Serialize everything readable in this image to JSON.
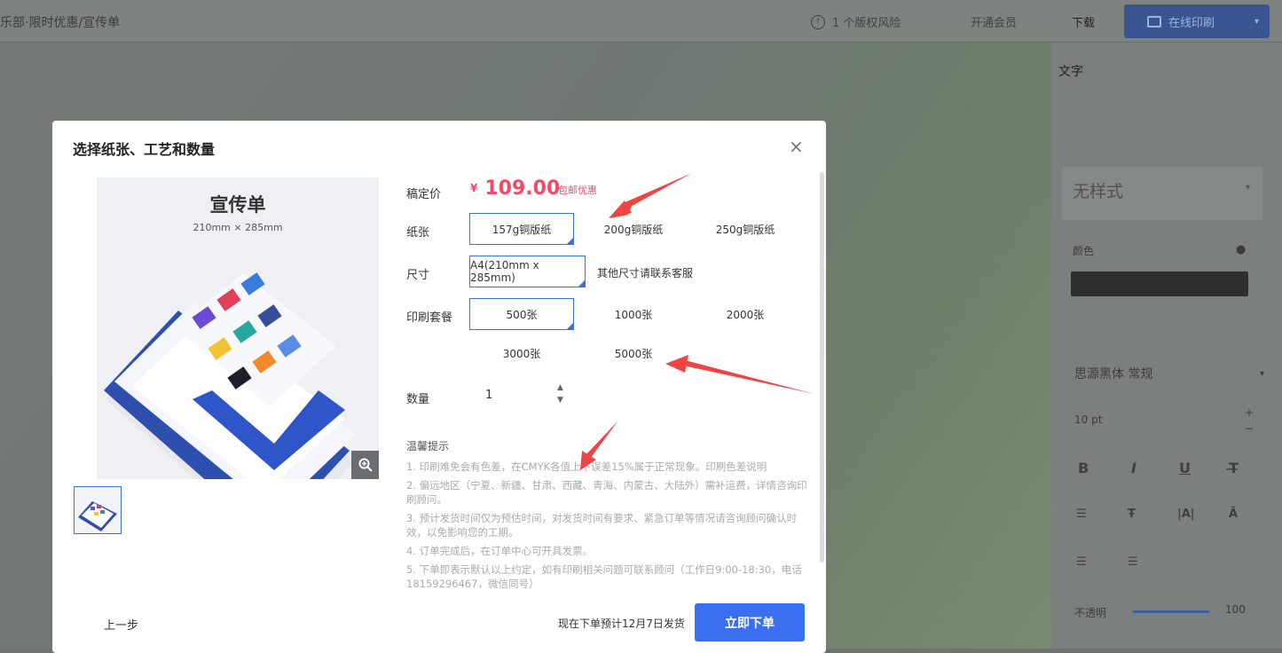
{
  "topbar": {
    "breadcrumb": "乐部·限时优惠/宣传单",
    "notice_icon": "!",
    "notice": "1 个版权风险",
    "member": "开通会员",
    "download": "下载",
    "print_button": "在线印刷",
    "print_caret": "▾"
  },
  "right_panel": {
    "title": "文字",
    "style_select": "无样式",
    "color_label": "颜色",
    "font_select": "思源黑体 常规",
    "font_size": "10 pt",
    "size_plus": "+",
    "size_minus": "−",
    "format_buttons": [
      "B",
      "I",
      "U",
      "T̶"
    ],
    "opacity_label": "不透明",
    "opacity_value": "100",
    "swatch_color": "#2c2d2c"
  },
  "modal": {
    "title": "选择纸张、工艺和数量",
    "close": "×",
    "product": {
      "title": "宣传单",
      "subtitle": "210mm × 285mm"
    },
    "price_label": "稿定价",
    "currency": "¥",
    "price": "109.00",
    "price_tag": "包邮优惠",
    "paper_label": "纸张",
    "papers": [
      "157g铜版纸",
      "200g铜版纸",
      "250g铜版纸"
    ],
    "size_label": "尺寸",
    "size_value": "A4(210mm x 285mm)",
    "size_note": "其他尺寸请联系客服",
    "package_label": "印刷套餐",
    "packages": [
      "500张",
      "1000张",
      "2000张",
      "3000张",
      "5000张"
    ],
    "quantity_label": "数量",
    "quantity": "1",
    "tips_title": "温馨提示",
    "tips": [
      "1. 印刷难免会有色差，在CMYK各值上下误差15%属于正常现象。印刷色差说明",
      "2. 偏远地区（宁夏、新疆、甘肃、西藏、青海、内蒙古、大陆外）需补运费，详情咨询印刷顾问。",
      "3. 预计发货时间仅为预估时间，对发货时间有要求、紧急订单等情况请咨询顾问确认时效，以免影响您的工期。",
      "4. 订单完成后，在订单中心可开具发票。",
      "5. 下单即表示默认以上约定，如有印刷相关问题可联系顾问（工作日9:00-18:30，电话18159296467，微信同号）"
    ],
    "back": "上一步",
    "ship_note": "现在下单预计12月7日发货",
    "order_button": "立即下单"
  },
  "colors": {
    "accent": "#3b6fe0",
    "price": "#f04a64",
    "order_button": "#3b6ff2",
    "annotation_arrow": "#ee4444"
  }
}
